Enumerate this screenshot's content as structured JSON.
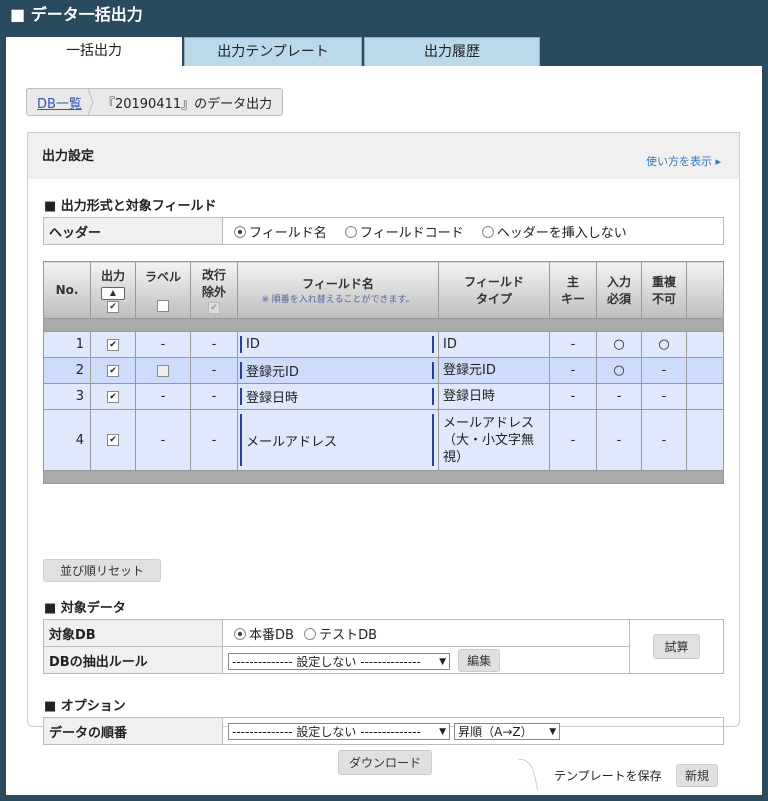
{
  "window_title": "■ データ一括出力",
  "tabs": [
    {
      "label": "一括出力"
    },
    {
      "label": "出力テンプレート"
    },
    {
      "label": "出力履歴"
    }
  ],
  "breadcrumb": {
    "link": "DB一覧",
    "current": "『20190411』のデータ出力"
  },
  "output_settings": {
    "title": "出力設定",
    "help_link": "使い方を表示 ▸"
  },
  "section_format": {
    "title": "■ 出力形式と対象フィールド",
    "header_label": "ヘッダー",
    "header_options": [
      "フィールド名",
      "フィールドコード",
      "ヘッダーを挿入しない"
    ],
    "header_selected": 0
  },
  "grid": {
    "columns": {
      "no": "No.",
      "output": "出力",
      "label": "ラベル",
      "newline1": "改行",
      "newline2": "除外",
      "field_name": "フィールド名",
      "field_hint": "※ 順番を入れ替えることができます。",
      "field_type1": "フィールド",
      "field_type2": "タイプ",
      "primary1": "主",
      "primary2": "キー",
      "required1": "入力",
      "required2": "必須",
      "unique1": "重複",
      "unique2": "不可"
    },
    "sort_icon": "▲",
    "rows": [
      {
        "no": "1",
        "label": "-",
        "newline": "-",
        "name": "ID",
        "type": "ID",
        "primary": "-",
        "required": "○",
        "unique": "○"
      },
      {
        "no": "2",
        "label": "",
        "newline": "-",
        "name": "登録元ID",
        "type": "登録元ID",
        "primary": "-",
        "required": "○",
        "unique": "-"
      },
      {
        "no": "3",
        "label": "-",
        "newline": "-",
        "name": "登録日時",
        "type": "登録日時",
        "primary": "-",
        "required": "-",
        "unique": "-"
      },
      {
        "no": "4",
        "label": "-",
        "newline": "-",
        "name": "メールアドレス",
        "type": "メールアドレス（大・小文字無視）",
        "primary": "-",
        "required": "-",
        "unique": "-"
      }
    ],
    "reset_button": "並び順リセット"
  },
  "section_target": {
    "title": "■ 対象データ",
    "db_label": "対象DB",
    "db_options": [
      "本番DB",
      "テストDB"
    ],
    "db_selected": 0,
    "rule_label": "DBの抽出ルール",
    "rule_value": "-------------- 設定しない --------------",
    "edit_button": "編集",
    "trial_button": "試算"
  },
  "section_option": {
    "title": "■ オプション",
    "order_label": "データの順番",
    "order_value": "-------------- 設定しない --------------",
    "order_dir": "昇順（A→Z）"
  },
  "save_template": {
    "label": "テンプレートを保存",
    "new_button": "新規"
  },
  "download_button": "ダウンロード"
}
